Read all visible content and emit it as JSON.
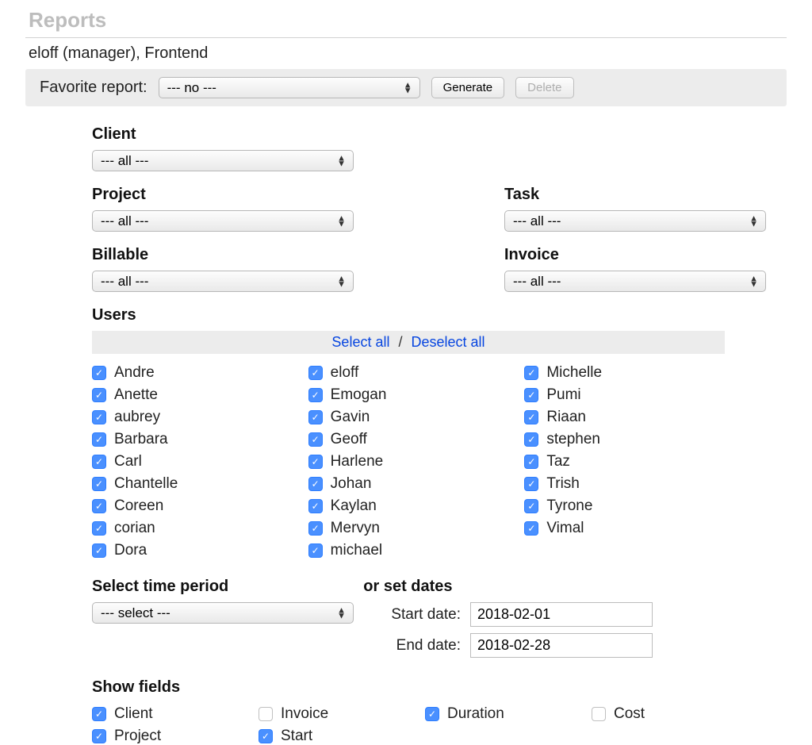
{
  "page_title": "Reports",
  "context": "eloff (manager), Frontend",
  "favorite": {
    "label": "Favorite report:",
    "selected": "--- no ---",
    "generate": "Generate",
    "delete": "Delete"
  },
  "filters": {
    "client_label": "Client",
    "client_selected": "--- all ---",
    "project_label": "Project",
    "project_selected": "--- all ---",
    "task_label": "Task",
    "task_selected": "--- all ---",
    "billable_label": "Billable",
    "billable_selected": "--- all ---",
    "invoice_label": "Invoice",
    "invoice_selected": "--- all ---"
  },
  "users": {
    "label": "Users",
    "select_all": "Select all",
    "deselect_all": "Deselect all",
    "separator": "/",
    "col1": [
      "Andre",
      "Anette",
      "aubrey",
      "Barbara",
      "Carl",
      "Chantelle",
      "Coreen",
      "corian",
      "Dora"
    ],
    "col2": [
      "eloff",
      "Emogan",
      "Gavin",
      "Geoff",
      "Harlene",
      "Johan",
      "Kaylan",
      "Mervyn",
      "michael"
    ],
    "col3": [
      "Michelle",
      "Pumi",
      "Riaan",
      "stephen",
      "Taz",
      "Trish",
      "Tyrone",
      "Vimal"
    ]
  },
  "time": {
    "period_label": "Select time period",
    "period_selected": "--- select ---",
    "or_label": "or set dates",
    "start_label": "Start date:",
    "start_value": "2018-02-01",
    "end_label": "End date:",
    "end_value": "2018-02-28"
  },
  "fields": {
    "label": "Show fields",
    "col1": [
      {
        "label": "Client",
        "checked": true
      },
      {
        "label": "Project",
        "checked": true
      }
    ],
    "col2": [
      {
        "label": "Invoice",
        "checked": false
      },
      {
        "label": "Start",
        "checked": true
      }
    ],
    "col3": [
      {
        "label": "Duration",
        "checked": true
      }
    ],
    "col4": [
      {
        "label": "Cost",
        "checked": false
      }
    ]
  }
}
